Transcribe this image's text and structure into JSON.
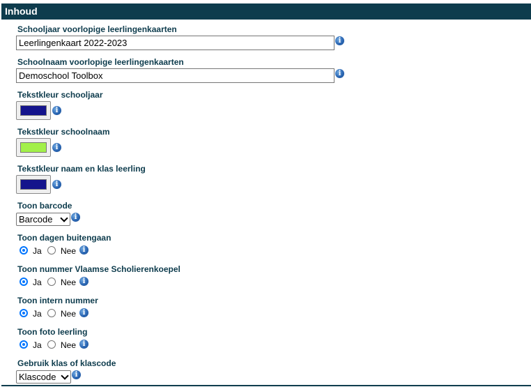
{
  "section": {
    "title": "Inhoud"
  },
  "fields": {
    "schooljaar": {
      "label": "Schooljaar voorlopige leerlingenkaarten",
      "value": "Leerlingenkaart 2022-2023"
    },
    "schoolnaam": {
      "label": "Schoolnaam voorlopige leerlingenkaarten",
      "value": "Demoschool Toolbox"
    },
    "kleur_schooljaar": {
      "label": "Tekstkleur schooljaar",
      "color": "#14148c"
    },
    "kleur_schoolnaam": {
      "label": "Tekstkleur schoolnaam",
      "color": "#a2f04a"
    },
    "kleur_leerling": {
      "label": "Tekstkleur naam en klas leerling",
      "color": "#14148c"
    },
    "barcode": {
      "label": "Toon barcode",
      "selected": "Barcode"
    },
    "dagen_buitengaan": {
      "label": "Toon dagen buitengaan",
      "yes": "Ja",
      "no": "Nee",
      "selected": "Ja"
    },
    "nummer_vsk": {
      "label": "Toon nummer Vlaamse Scholierenkoepel",
      "yes": "Ja",
      "no": "Nee",
      "selected": "Ja"
    },
    "intern_nummer": {
      "label": "Toon intern nummer",
      "yes": "Ja",
      "no": "Nee",
      "selected": "Ja"
    },
    "foto_leerling": {
      "label": "Toon foto leerling",
      "yes": "Ja",
      "no": "Nee",
      "selected": "Ja"
    },
    "klas_klascode": {
      "label": "Gebruik klas of klascode",
      "selected": "Klascode"
    }
  },
  "icons": {
    "info": "info-icon",
    "info_glyph": "i"
  },
  "colors": {
    "header_bg": "#0e3c4d",
    "label": "#0e3c4d",
    "radio_accent": "#0075ff"
  }
}
